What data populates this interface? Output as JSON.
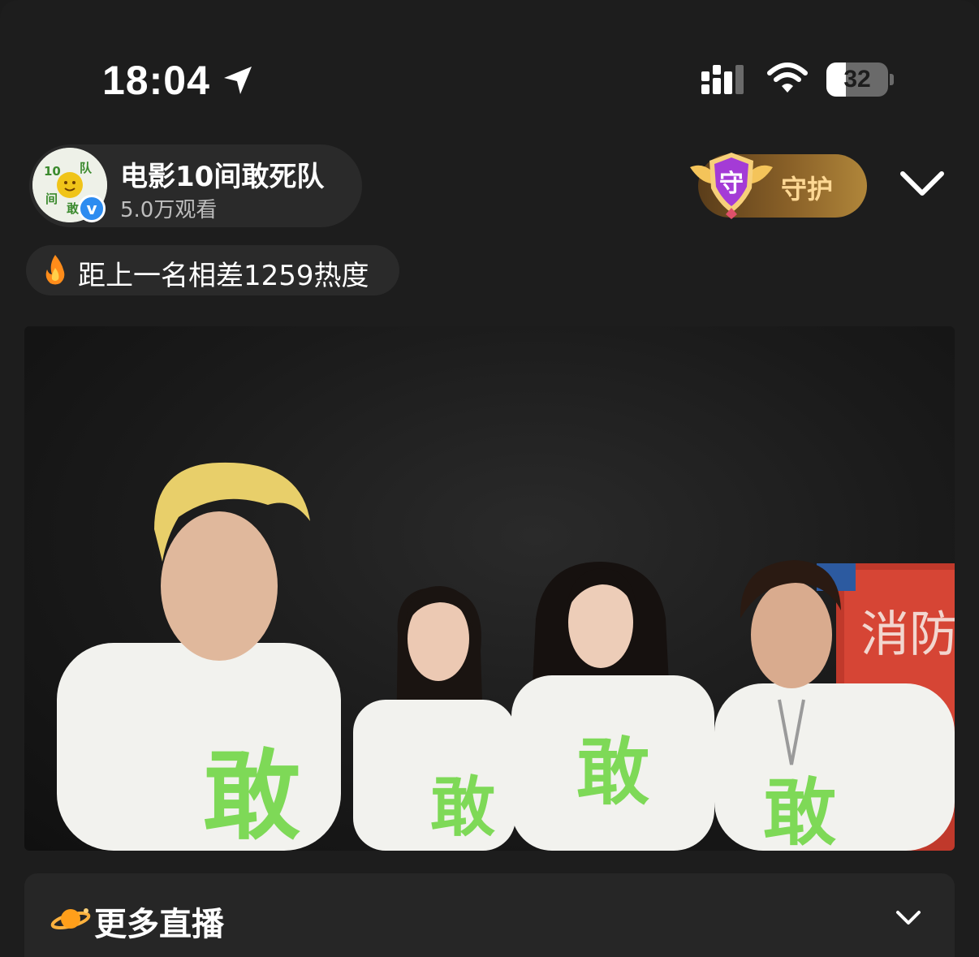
{
  "status_bar": {
    "time": "18:04",
    "battery_level": "32",
    "battery_fraction": 0.32
  },
  "host": {
    "name": "电影10间敢死队",
    "views": "5.0万观看",
    "avatar_text": [
      "10",
      "间",
      "敢",
      "队"
    ]
  },
  "guard": {
    "badge_char": "守",
    "label": "守护"
  },
  "heat": {
    "text": "距上一名相差1259热度"
  },
  "video": {
    "sign_text": "消防",
    "shirt_text": "敢"
  },
  "more_live": {
    "label": "更多直播"
  },
  "icons": {
    "location": "location-arrow-icon",
    "signal": "cellular-signal-icon",
    "wifi": "wifi-icon",
    "collapse": "chevron-down-icon",
    "fire": "fire-icon",
    "planet": "planet-icon"
  },
  "colors": {
    "background": "#1d1d1d",
    "pill": "#2a2a2a",
    "guard_text": "#ffd894",
    "guard_badge": "#a43bd6",
    "shirt_green": "#7ed957",
    "verified": "#2d8cf0"
  }
}
